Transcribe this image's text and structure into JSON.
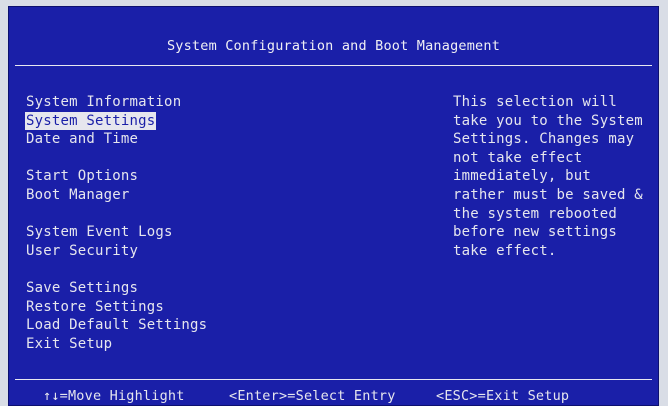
{
  "title": "System Configuration and Boot Management",
  "menu": {
    "items": [
      {
        "label": "System Information",
        "selected": false
      },
      {
        "label": "System Settings",
        "selected": true
      },
      {
        "label": "Date and Time",
        "selected": false
      },
      {
        "label": "Start Options",
        "selected": false
      },
      {
        "label": "Boot Manager",
        "selected": false
      },
      {
        "label": "System Event Logs",
        "selected": false
      },
      {
        "label": "User Security",
        "selected": false
      },
      {
        "label": "Save Settings",
        "selected": false
      },
      {
        "label": "Restore Settings",
        "selected": false
      },
      {
        "label": "Load Default Settings",
        "selected": false
      },
      {
        "label": "Exit Setup",
        "selected": false
      }
    ]
  },
  "help": {
    "lines": [
      "This selection will",
      "take you to the System",
      "Settings. Changes may",
      "not take effect",
      "immediately, but",
      "rather must be saved &",
      "the system rebooted",
      "before new settings",
      "take effect."
    ]
  },
  "footer": {
    "move": "↑↓=Move Highlight",
    "select": "<Enter>=Select Entry",
    "exit": "<ESC>=Exit Setup"
  },
  "colors": {
    "background": "#1a1fa8",
    "text": "#e6e6ee",
    "highlight": "#e6e6ee"
  }
}
